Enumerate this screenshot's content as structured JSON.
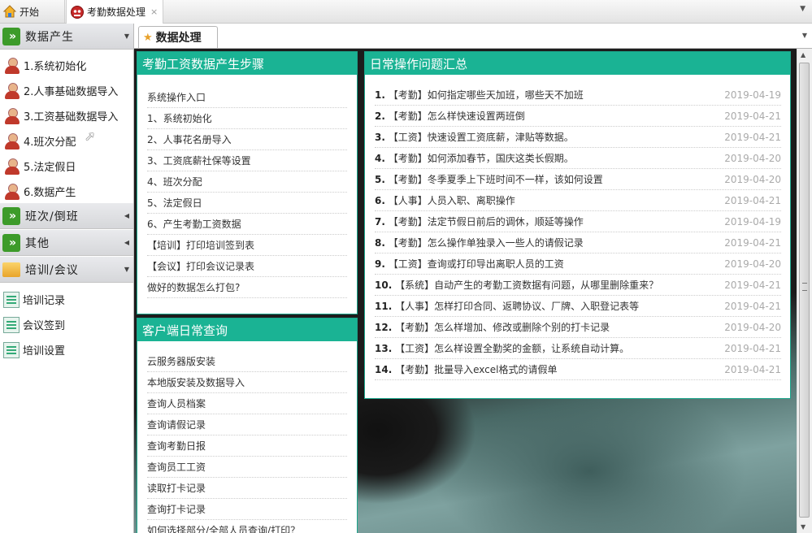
{
  "top_tabs": [
    {
      "label": "开始",
      "icon": "home-icon",
      "closable": false
    },
    {
      "label": "考勤数据处理",
      "icon": "app-icon",
      "closable": true,
      "close_glyph": "×"
    }
  ],
  "sidebar": {
    "groups": [
      {
        "label": "数据产生",
        "expanded": true,
        "items": [
          {
            "label": "1.系统初始化",
            "icon": "person-icon"
          },
          {
            "label": "2.人事基础数据导入",
            "icon": "person-icon"
          },
          {
            "label": "3.工资基础数据导入",
            "icon": "person-icon"
          },
          {
            "label": "4.班次分配",
            "icon": "person-icon"
          },
          {
            "label": "5.法定假日",
            "icon": "person-icon"
          },
          {
            "label": "6.数据产生",
            "icon": "person-icon"
          }
        ]
      },
      {
        "label": "班次/倒班",
        "expanded": false,
        "items": []
      },
      {
        "label": "其他",
        "expanded": false,
        "items": []
      },
      {
        "label": "培训/会议",
        "expanded": true,
        "items": [
          {
            "label": "培训记录",
            "icon": "training-record-icon"
          },
          {
            "label": "会议签到",
            "icon": "meeting-signin-icon"
          },
          {
            "label": "培训设置",
            "icon": "training-settings-icon"
          }
        ]
      }
    ]
  },
  "inner_tab": {
    "label": "数据处理"
  },
  "panels": {
    "steps": {
      "title": "考勤工资数据产生步骤",
      "links": [
        "系统操作入口",
        "1、系统初始化",
        "2、人事花名册导入",
        "3、工资底薪社保等设置",
        "4、班次分配",
        "5、法定假日",
        "6、产生考勤工资数据",
        "【培训】打印培训签到表",
        "【会议】打印会议记录表",
        "做好的数据怎么打包?"
      ]
    },
    "client_query": {
      "title": "客户端日常查询",
      "links": [
        "云服务器版安装",
        "本地版安装及数据导入",
        "查询人员档案",
        "查询请假记录",
        "查询考勤日报",
        "查询员工工资",
        "读取打卡记录",
        "查询打卡记录",
        "如何选择部分/全部人员查询/打印？"
      ]
    },
    "faq": {
      "title": "日常操作问题汇总",
      "items": [
        {
          "num": "1.",
          "text": "【考勤】如何指定哪些天加班，哪些天不加班",
          "date": "2019-04-19"
        },
        {
          "num": "2.",
          "text": "【考勤】怎么样快速设置两班倒",
          "date": "2019-04-21"
        },
        {
          "num": "3.",
          "text": "【工资】快速设置工资底薪，津贴等数据。",
          "date": "2019-04-21"
        },
        {
          "num": "4.",
          "text": "【考勤】如何添加春节，国庆这类长假期。",
          "date": "2019-04-20"
        },
        {
          "num": "5.",
          "text": "【考勤】冬季夏季上下班时间不一样，该如何设置",
          "date": "2019-04-20"
        },
        {
          "num": "6.",
          "text": "【人事】人员入职、离职操作",
          "date": "2019-04-21"
        },
        {
          "num": "7.",
          "text": "【考勤】法定节假日前后的调休，顺延等操作",
          "date": "2019-04-19"
        },
        {
          "num": "8.",
          "text": "【考勤】怎么操作单独录入一些人的请假记录",
          "date": "2019-04-21"
        },
        {
          "num": "9.",
          "text": "【工资】查询或打印导出离职人员的工资",
          "date": "2019-04-20"
        },
        {
          "num": "10.",
          "text": "【系统】自动产生的考勤工资数据有问题，从哪里删除重来？",
          "date": "2019-04-21"
        },
        {
          "num": "11.",
          "text": "【人事】怎样打印合同、返聘协议、厂牌、入职登记表等",
          "date": "2019-04-21"
        },
        {
          "num": "12.",
          "text": "【考勤】怎么样增加、修改或删除个别的打卡记录",
          "date": "2019-04-20"
        },
        {
          "num": "13.",
          "text": "【工资】怎么样设置全勤奖的金额，让系统自动计算。",
          "date": "2019-04-21"
        },
        {
          "num": "14.",
          "text": "【考勤】批量导入excel格式的请假单",
          "date": "2019-04-21"
        }
      ]
    }
  },
  "colors": {
    "panel_header": "#1ab394",
    "panel_border": "#1aa58a",
    "accordion_icon": "#3d9b2a"
  }
}
